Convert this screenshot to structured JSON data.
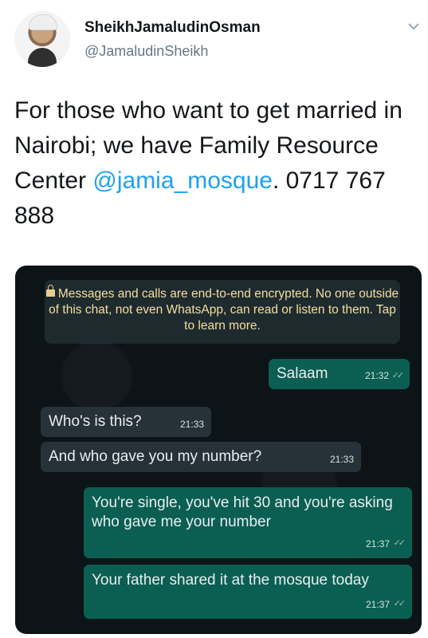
{
  "user": {
    "display_name": "SheikhJamaludinOsman",
    "handle": "@JamaludinSheikh"
  },
  "tweet": {
    "text_before": "For those who want to get married in Nairobi; we have Family Resource Center ",
    "mention": "@jamia_mosque",
    "text_after": ". 0717 767 888"
  },
  "chat": {
    "encryption_notice": "Messages and calls are end-to-end encrypted. No one outside of this chat, not even WhatsApp, can read or listen to them. Tap to learn more.",
    "messages": [
      {
        "direction": "out",
        "text": "Salaam",
        "time": "21:32"
      },
      {
        "direction": "in",
        "text": "Who's is this?",
        "time": "21:33"
      },
      {
        "direction": "in",
        "text": "And who gave you my number?",
        "time": "21:33"
      },
      {
        "direction": "out",
        "text": "You're single, you've hit 30 and you're asking who gave me your number",
        "time": "21:37"
      },
      {
        "direction": "out",
        "text": "Your father shared it at the mosque today",
        "time": "21:37"
      }
    ],
    "colors": {
      "background": "#0d1418",
      "outgoing_bubble": "#0a5f52",
      "incoming_bubble": "#263238",
      "notice_bg": "#1f2a2f",
      "notice_text": "#f1dfa1"
    },
    "icons": {
      "lock": "lock-icon",
      "read_receipt": "double-check-icon"
    }
  },
  "ui": {
    "menu_icon": "chevron-down-icon"
  }
}
